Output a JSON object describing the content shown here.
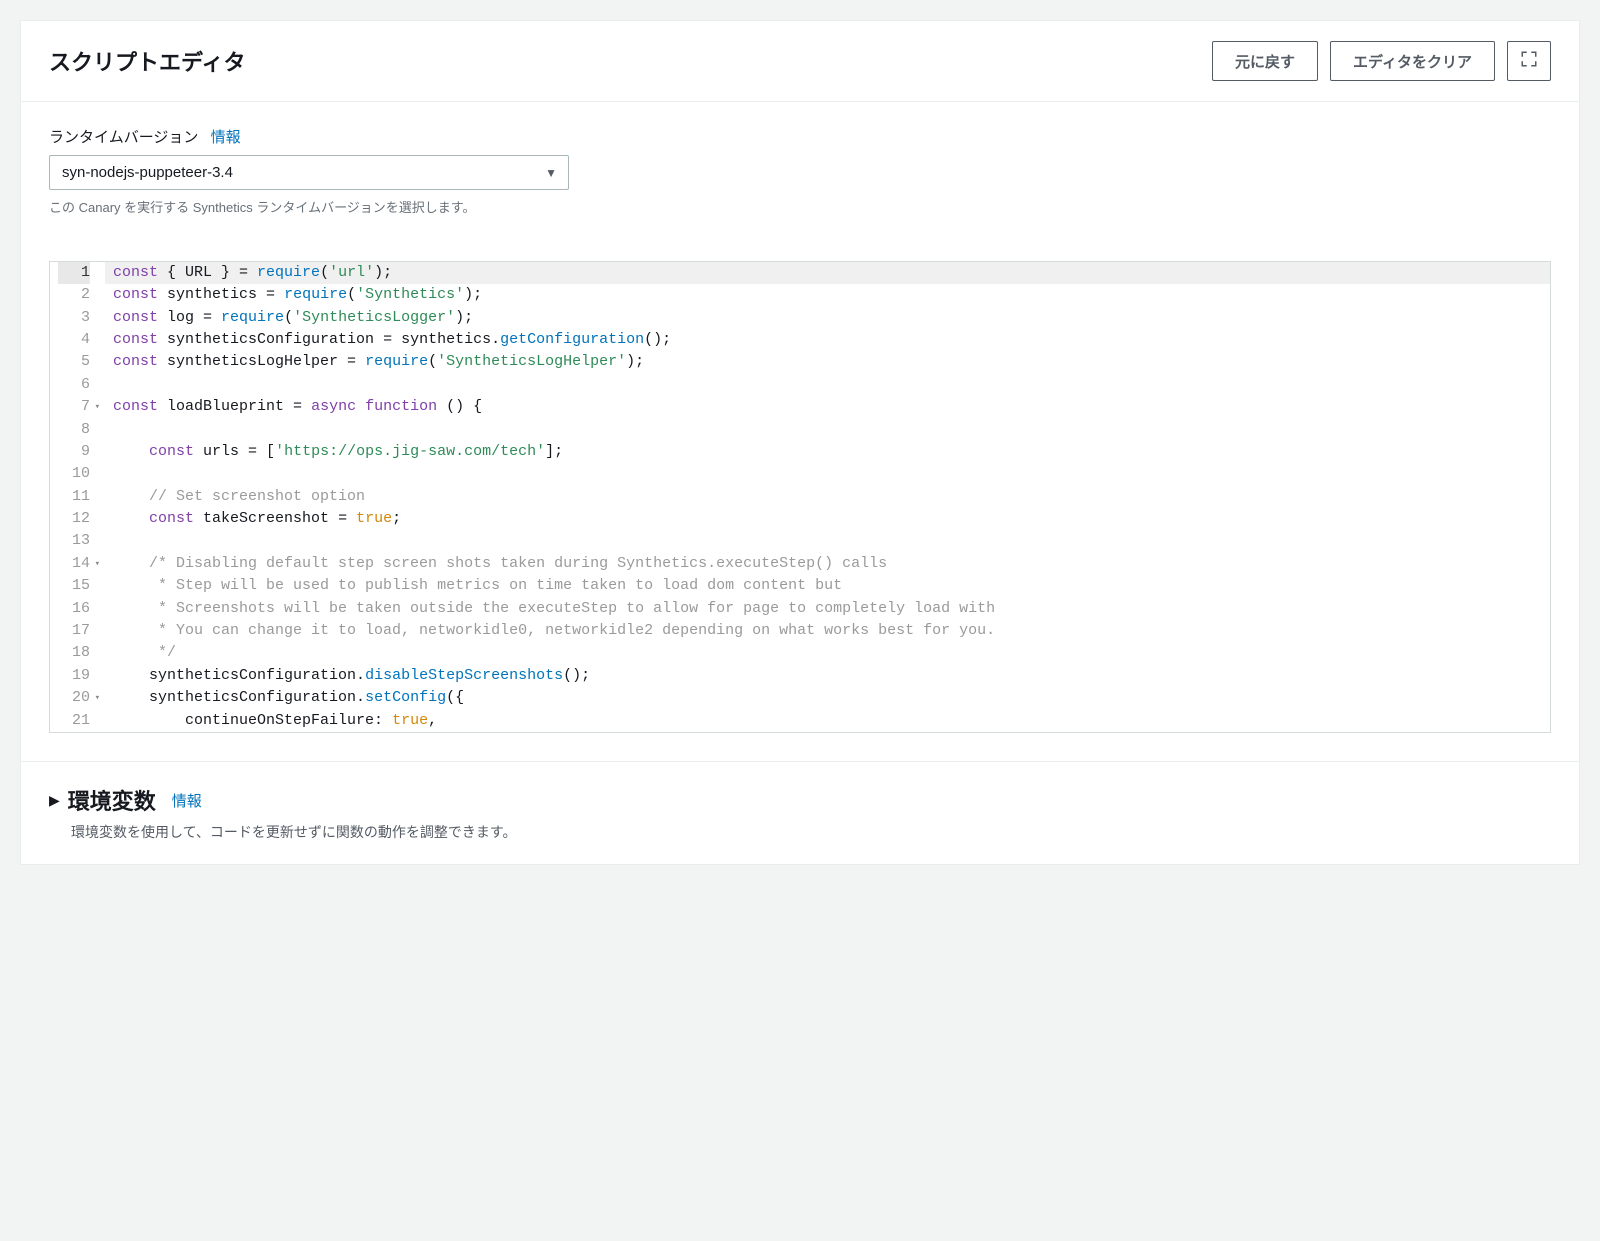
{
  "header": {
    "title": "スクリプトエディタ",
    "revert_button": "元に戻す",
    "clear_button": "エディタをクリア"
  },
  "runtime": {
    "label": "ランタイムバージョン",
    "info_label": "情報",
    "selected": "syn-nodejs-puppeteer-3.4",
    "help": "この Canary を実行する Synthetics ランタイムバージョンを選択します。"
  },
  "editor": {
    "lines": [
      {
        "n": 1,
        "active": true,
        "fold": false,
        "tokens": [
          {
            "t": "kw",
            "v": "const"
          },
          {
            "t": "var",
            "v": " { URL } "
          },
          {
            "t": "punct",
            "v": "= "
          },
          {
            "t": "fn",
            "v": "require"
          },
          {
            "t": "punct",
            "v": "("
          },
          {
            "t": "str",
            "v": "'url'"
          },
          {
            "t": "punct",
            "v": ");"
          }
        ]
      },
      {
        "n": 2,
        "tokens": [
          {
            "t": "kw",
            "v": "const"
          },
          {
            "t": "var",
            "v": " synthetics "
          },
          {
            "t": "punct",
            "v": "= "
          },
          {
            "t": "fn",
            "v": "require"
          },
          {
            "t": "punct",
            "v": "("
          },
          {
            "t": "str",
            "v": "'Synthetics'"
          },
          {
            "t": "punct",
            "v": ");"
          }
        ]
      },
      {
        "n": 3,
        "tokens": [
          {
            "t": "kw",
            "v": "const"
          },
          {
            "t": "var",
            "v": " log "
          },
          {
            "t": "punct",
            "v": "= "
          },
          {
            "t": "fn",
            "v": "require"
          },
          {
            "t": "punct",
            "v": "("
          },
          {
            "t": "str",
            "v": "'SyntheticsLogger'"
          },
          {
            "t": "punct",
            "v": ");"
          }
        ]
      },
      {
        "n": 4,
        "tokens": [
          {
            "t": "kw",
            "v": "const"
          },
          {
            "t": "var",
            "v": " syntheticsConfiguration "
          },
          {
            "t": "punct",
            "v": "= "
          },
          {
            "t": "var",
            "v": "synthetics"
          },
          {
            "t": "punct",
            "v": "."
          },
          {
            "t": "fn",
            "v": "getConfiguration"
          },
          {
            "t": "punct",
            "v": "();"
          }
        ]
      },
      {
        "n": 5,
        "tokens": [
          {
            "t": "kw",
            "v": "const"
          },
          {
            "t": "var",
            "v": " syntheticsLogHelper "
          },
          {
            "t": "punct",
            "v": "= "
          },
          {
            "t": "fn",
            "v": "require"
          },
          {
            "t": "punct",
            "v": "("
          },
          {
            "t": "str",
            "v": "'SyntheticsLogHelper'"
          },
          {
            "t": "punct",
            "v": ");"
          }
        ]
      },
      {
        "n": 6,
        "tokens": []
      },
      {
        "n": 7,
        "fold": true,
        "tokens": [
          {
            "t": "kw",
            "v": "const"
          },
          {
            "t": "var",
            "v": " loadBlueprint "
          },
          {
            "t": "punct",
            "v": "= "
          },
          {
            "t": "kw",
            "v": "async"
          },
          {
            "t": "var",
            "v": " "
          },
          {
            "t": "kw",
            "v": "function"
          },
          {
            "t": "punct",
            "v": " () {"
          }
        ]
      },
      {
        "n": 8,
        "tokens": []
      },
      {
        "n": 9,
        "tokens": [
          {
            "t": "var",
            "v": "    "
          },
          {
            "t": "kw",
            "v": "const"
          },
          {
            "t": "var",
            "v": " urls "
          },
          {
            "t": "punct",
            "v": "= ["
          },
          {
            "t": "str",
            "v": "'https://ops.jig-saw.com/tech'"
          },
          {
            "t": "punct",
            "v": "];"
          }
        ]
      },
      {
        "n": 10,
        "tokens": []
      },
      {
        "n": 11,
        "tokens": [
          {
            "t": "var",
            "v": "    "
          },
          {
            "t": "com",
            "v": "// Set screenshot option"
          }
        ]
      },
      {
        "n": 12,
        "tokens": [
          {
            "t": "var",
            "v": "    "
          },
          {
            "t": "kw",
            "v": "const"
          },
          {
            "t": "var",
            "v": " takeScreenshot "
          },
          {
            "t": "punct",
            "v": "= "
          },
          {
            "t": "bool",
            "v": "true"
          },
          {
            "t": "punct",
            "v": ";"
          }
        ]
      },
      {
        "n": 13,
        "tokens": []
      },
      {
        "n": 14,
        "fold": true,
        "tokens": [
          {
            "t": "var",
            "v": "    "
          },
          {
            "t": "com",
            "v": "/* Disabling default step screen shots taken during Synthetics.executeStep() calls"
          }
        ]
      },
      {
        "n": 15,
        "tokens": [
          {
            "t": "var",
            "v": "    "
          },
          {
            "t": "com",
            "v": " * Step will be used to publish metrics on time taken to load dom content but"
          }
        ]
      },
      {
        "n": 16,
        "tokens": [
          {
            "t": "var",
            "v": "    "
          },
          {
            "t": "com",
            "v": " * Screenshots will be taken outside the executeStep to allow for page to completely load with"
          }
        ]
      },
      {
        "n": 17,
        "tokens": [
          {
            "t": "var",
            "v": "    "
          },
          {
            "t": "com",
            "v": " * You can change it to load, networkidle0, networkidle2 depending on what works best for you."
          }
        ]
      },
      {
        "n": 18,
        "tokens": [
          {
            "t": "var",
            "v": "    "
          },
          {
            "t": "com",
            "v": " */"
          }
        ]
      },
      {
        "n": 19,
        "tokens": [
          {
            "t": "var",
            "v": "    syntheticsConfiguration"
          },
          {
            "t": "punct",
            "v": "."
          },
          {
            "t": "fn",
            "v": "disableStepScreenshots"
          },
          {
            "t": "punct",
            "v": "();"
          }
        ]
      },
      {
        "n": 20,
        "fold": true,
        "tokens": [
          {
            "t": "var",
            "v": "    syntheticsConfiguration"
          },
          {
            "t": "punct",
            "v": "."
          },
          {
            "t": "fn",
            "v": "setConfig"
          },
          {
            "t": "punct",
            "v": "({"
          }
        ]
      },
      {
        "n": 21,
        "tokens": [
          {
            "t": "var",
            "v": "        continueOnStepFailure"
          },
          {
            "t": "punct",
            "v": ": "
          },
          {
            "t": "bool",
            "v": "true"
          },
          {
            "t": "punct",
            "v": ","
          }
        ]
      }
    ]
  },
  "env_section": {
    "title": "環境変数",
    "info_label": "情報",
    "description": "環境変数を使用して、コードを更新せずに関数の動作を調整できます。"
  }
}
